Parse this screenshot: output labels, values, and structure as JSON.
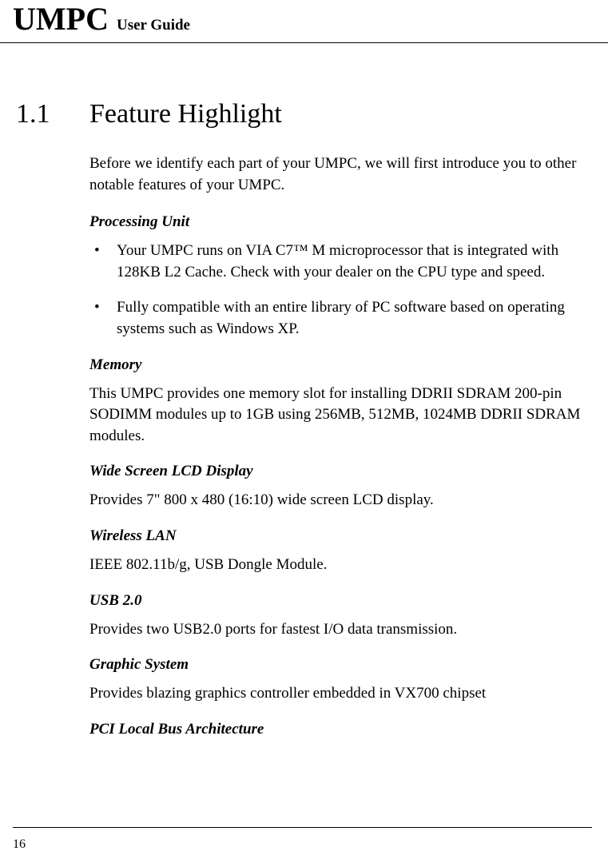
{
  "header": {
    "brand": "UMPC",
    "sub": "User Guide"
  },
  "section": {
    "number": "1.1",
    "title": "Feature Highlight",
    "intro": "Before we identify each part of your UMPC, we will first introduce you to other notable features of your UMPC."
  },
  "processing": {
    "heading": "Processing Unit",
    "bullets": [
      "Your UMPC runs on VIA C7™ M microprocessor that is integrated with 128KB L2 Cache. Check with your dealer on the CPU type and speed.",
      "Fully compatible with an entire library of PC software based on operating systems such as Windows XP."
    ]
  },
  "memory": {
    "heading": "Memory",
    "body": "This UMPC provides one memory slot for installing DDRII SDRAM 200-pin SODIMM modules up to 1GB using 256MB, 512MB, 1024MB DDRII SDRAM modules."
  },
  "display": {
    "heading": "Wide Screen LCD Display",
    "body": "Provides 7\" 800 x 480 (16:10) wide screen LCD display."
  },
  "wlan": {
    "heading": "Wireless LAN",
    "body": "IEEE 802.11b/g, USB Dongle Module."
  },
  "usb": {
    "heading": "USB 2.0",
    "body": "Provides two USB2.0 ports for fastest I/O data transmission."
  },
  "graphic": {
    "heading": "Graphic System",
    "body": "Provides blazing graphics controller embedded in VX700 chipset"
  },
  "pci": {
    "heading": "PCI Local Bus Architecture"
  },
  "page_number": "16"
}
